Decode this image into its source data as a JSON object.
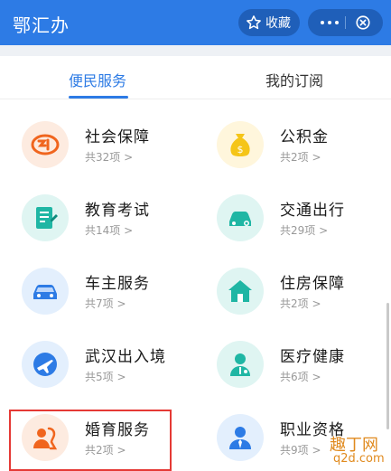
{
  "header": {
    "title": "鄂汇办",
    "favorite_label": "收藏",
    "favorite_icon": "star-icon",
    "more_icon": "more-dots-icon",
    "close_icon": "close-circle-icon",
    "bg_color": "#2d7be5"
  },
  "tabs": [
    {
      "label": "便民服务",
      "active": true
    },
    {
      "label": "我的订阅",
      "active": false
    }
  ],
  "services": [
    {
      "title": "社会保障",
      "count": "共32项 >",
      "icon": "social-security-icon",
      "bg": "#fdebe0"
    },
    {
      "title": "公积金",
      "count": "共2项 >",
      "icon": "money-bag-icon",
      "bg": "#fff6dc"
    },
    {
      "title": "教育考试",
      "count": "共14项 >",
      "icon": "exam-paper-icon",
      "bg": "#dff5f2"
    },
    {
      "title": "交通出行",
      "count": "共29项 >",
      "icon": "car-icon",
      "bg": "#dff5f2"
    },
    {
      "title": "车主服务",
      "count": "共7项 >",
      "icon": "car-front-icon",
      "bg": "#e3effd"
    },
    {
      "title": "住房保障",
      "count": "共2项 >",
      "icon": "house-icon",
      "bg": "#dff5f2"
    },
    {
      "title": "武汉出入境",
      "count": "共5项 >",
      "icon": "plane-icon",
      "bg": "#e3effd"
    },
    {
      "title": "医疗健康",
      "count": "共6项 >",
      "icon": "doctor-icon",
      "bg": "#dff5f2"
    },
    {
      "title": "婚育服务",
      "count": "共2项 >",
      "icon": "couple-icon",
      "bg": "#fdebe0"
    },
    {
      "title": "职业资格",
      "count": "共9项 >",
      "icon": "professional-icon",
      "bg": "#e3effd"
    }
  ],
  "watermark": {
    "logo": "趣丁网",
    "url": "q2d.com"
  }
}
